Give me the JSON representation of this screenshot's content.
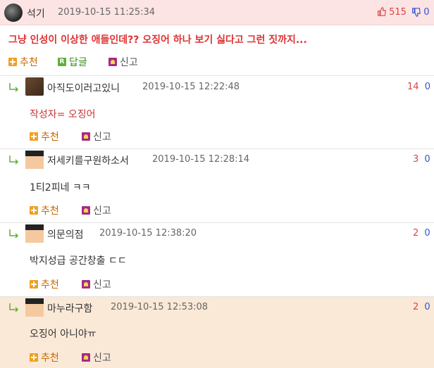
{
  "post": {
    "author": "석기",
    "date": "2019-10-15 11:25:34",
    "upvotes": "515",
    "downvotes": "0",
    "content": "그냥 인성이 이상한 애들인데?? 오징어 하나 보기 싫다고 그런 짓까지...",
    "actions": {
      "recommend": "추천",
      "reply": "답글",
      "report": "신고"
    }
  },
  "replies": [
    {
      "author": "아직도이러고있니",
      "date": "2019-10-15 12:22:48",
      "up": "14",
      "down": "0",
      "content": "작성자= 오징어",
      "content_color": "#cc3333",
      "avatar": "photo",
      "recommend": "추천",
      "report": "신고"
    },
    {
      "author": "저세키를구원하소서",
      "date": "2019-10-15 12:28:14",
      "up": "3",
      "down": "0",
      "content": "1티2피네 ㅋㅋ",
      "content_color": "#333333",
      "avatar": "pixel",
      "recommend": "추천",
      "report": "신고"
    },
    {
      "author": "의문의점",
      "date": "2019-10-15 12:38:20",
      "up": "2",
      "down": "0",
      "content": "박지성급 공간창출 ㄷㄷ",
      "content_color": "#333333",
      "avatar": "pixel",
      "recommend": "추천",
      "report": "신고"
    },
    {
      "author": "마누라구함",
      "date": "2019-10-15 12:53:08",
      "up": "2",
      "down": "0",
      "content": "오징어 아니야ㅠ",
      "content_color": "#333333",
      "avatar": "pixel",
      "recommend": "추천",
      "report": "신고"
    }
  ],
  "icons": {
    "thumb_up": "thumbs-up-icon",
    "thumb_down": "thumbs-down-icon",
    "reply_arrow": "reply-arrow-icon"
  },
  "colors": {
    "accent_red": "#dd3333",
    "vote_down": "#3355cc",
    "header_bg": "#fde4e4",
    "highlight_bg": "#fbe9d8"
  }
}
